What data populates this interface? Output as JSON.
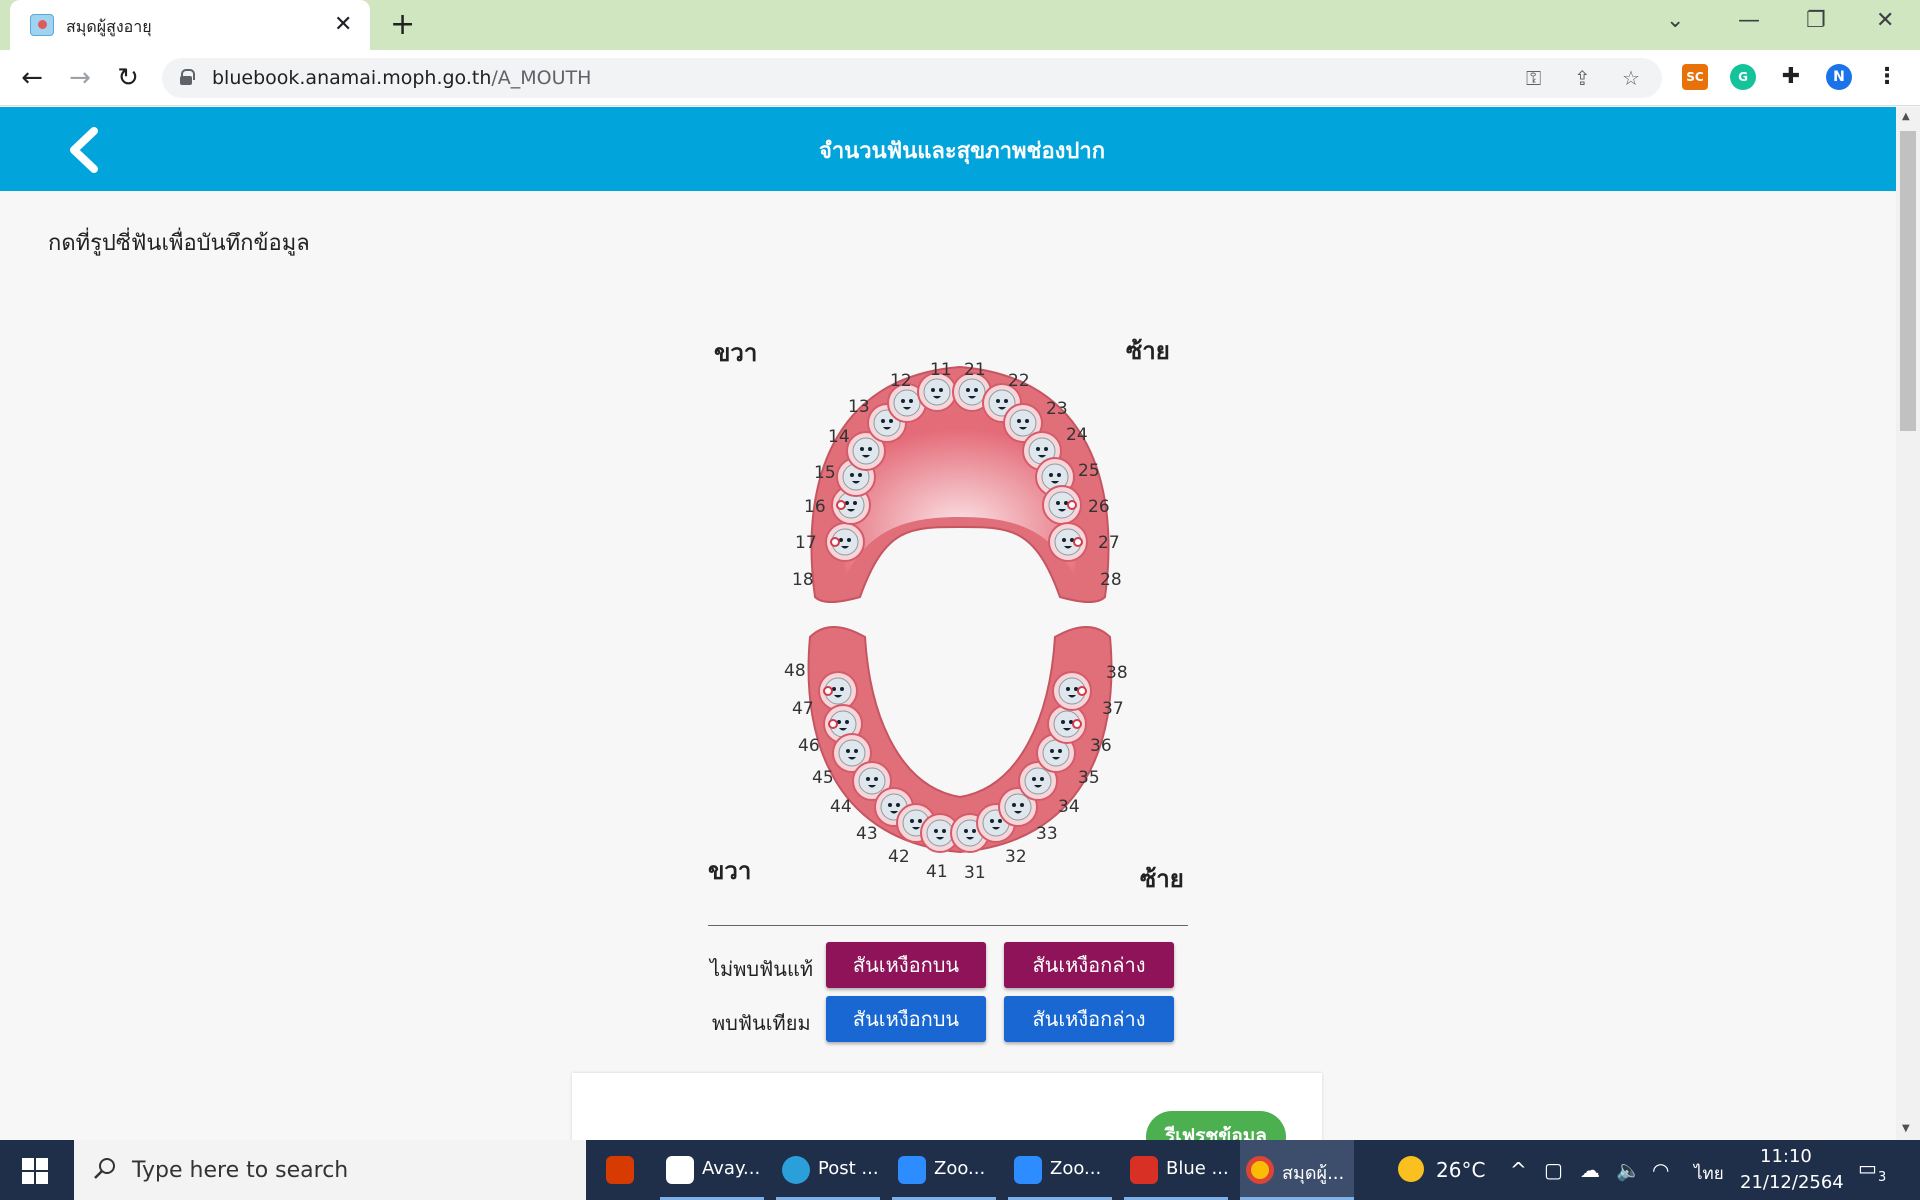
{
  "browser": {
    "tab_title": "สมุดผู้สูงอายุ",
    "url_domain": "bluebook.anamai.moph.go.th",
    "url_path": "/A_MOUTH",
    "profile_initial": "N",
    "extension_sc": "SC"
  },
  "header": {
    "title": "จำนวนฟันและสุขภาพช่องปาก"
  },
  "instruction": "กดที่รูปซี่ฟันเพื่อบันทึกข้อมูล",
  "sides": {
    "upper_right": "ขวา",
    "upper_left": "ซ้าย",
    "lower_right": "ขวา",
    "lower_left": "ซ้าย"
  },
  "upper_teeth": [
    "18",
    "17",
    "16",
    "15",
    "14",
    "13",
    "12",
    "11",
    "21",
    "22",
    "23",
    "24",
    "25",
    "26",
    "27",
    "28"
  ],
  "lower_teeth": [
    "48",
    "47",
    "46",
    "45",
    "44",
    "43",
    "42",
    "41",
    "31",
    "32",
    "33",
    "34",
    "35",
    "36",
    "37",
    "38"
  ],
  "no_real_teeth": {
    "label": "ไม่พบฟันแท้",
    "upper_btn": "สันเหงือกบน",
    "lower_btn": "สันเหงือกล่าง"
  },
  "denture": {
    "label": "พบฟันเทียม",
    "upper_btn": "สันเหงือกบน",
    "lower_btn": "สันเหงือกล่าง"
  },
  "refresh_label": "รีเฟรชข้อมูล",
  "colors": {
    "header": "#02a5db",
    "maroon_button": "#8e1358",
    "blue_button": "#1967d2",
    "gum": "#e06f7a"
  },
  "taskbar": {
    "search_placeholder": "Type here to search",
    "apps": [
      {
        "label": "Avay..."
      },
      {
        "label": "Post ..."
      },
      {
        "label": "Zoo..."
      },
      {
        "label": "Zoo..."
      },
      {
        "label": "Blue ..."
      },
      {
        "label": "สมุดผู้..."
      }
    ],
    "temperature": "26°C",
    "language": "ไทย",
    "time": "11:10",
    "date": "21/12/2564",
    "notifications": "3"
  }
}
